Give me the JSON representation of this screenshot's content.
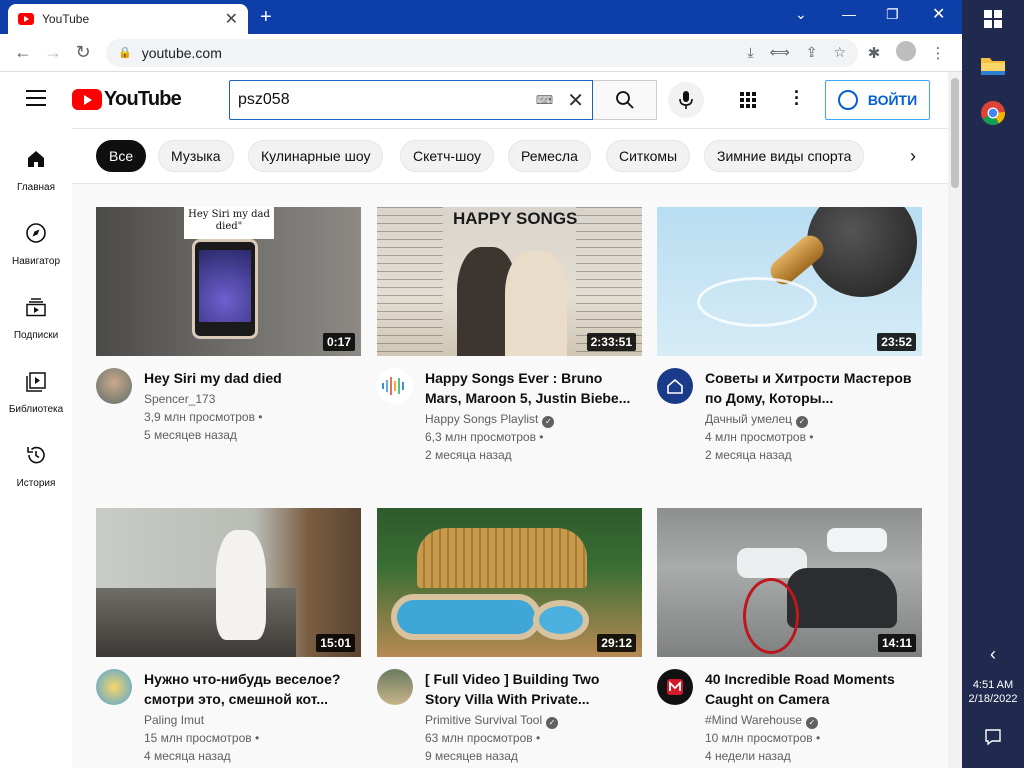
{
  "browser": {
    "tab_title": "YouTube",
    "url": "youtube.com"
  },
  "header": {
    "logo_text": "YouTube",
    "search_value": "psz058",
    "signin_label": "ВОЙТИ"
  },
  "chips": [
    "Все",
    "Музыка",
    "Кулинарные шоу",
    "Скетч-шоу",
    "Ремесла",
    "Ситкомы",
    "Зимние виды спорта"
  ],
  "sidebar": [
    {
      "label": "Главная",
      "icon": "home-icon"
    },
    {
      "label": "Навигатор",
      "icon": "compass-icon"
    },
    {
      "label": "Подписки",
      "icon": "subscriptions-icon"
    },
    {
      "label": "Библиотека",
      "icon": "library-icon"
    },
    {
      "label": "История",
      "icon": "history-icon"
    }
  ],
  "videos": [
    {
      "title": "Hey Siri my dad died",
      "channel": "Spencer_173",
      "views": "3,9 млн просмотров •",
      "age": "5 месяцев назад",
      "duration": "0:17",
      "verified": false
    },
    {
      "title": "Happy Songs Ever : Bruno Mars, Maroon 5, Justin Biebe...",
      "channel": "Happy Songs Playlist",
      "views": "6,3 млн просмотров •",
      "age": "2 месяца назад",
      "duration": "2:33:51",
      "verified": true
    },
    {
      "title": "Советы и Хитрости Мастеров по Дому, Которы...",
      "channel": "Дачный умелец",
      "views": "4 млн просмотров •",
      "age": "2 месяца назад",
      "duration": "23:52",
      "verified": true
    },
    {
      "title": "Нужно что-нибудь веселое? смотри это, смешной кот...",
      "channel": "Paling Imut",
      "views": "15 млн просмотров •",
      "age": "4 месяца назад",
      "duration": "15:01",
      "verified": false
    },
    {
      "title": "[ Full Video ] Building Two Story Villa With Private...",
      "channel": "Primitive Survival Tool",
      "views": "63 млн просмотров •",
      "age": "9 месяцев назад",
      "duration": "29:12",
      "verified": true
    },
    {
      "title": "40 Incredible Road Moments Caught on Camera",
      "channel": "#Mind Warehouse",
      "views": "10 млн просмотров •",
      "age": "4 недели назад",
      "duration": "14:11",
      "verified": true
    }
  ],
  "thumb_text": {
    "siri": "Hey Siri my dad died\"",
    "happy": "HAPPY SONGS"
  },
  "taskbar": {
    "time": "4:51 AM",
    "date": "2/18/2022"
  },
  "colors": {
    "brand_red": "#ff0000",
    "link_blue": "#065fd4",
    "chrome_blue": "#0e3ea8",
    "taskbar": "#1f2a4e"
  }
}
